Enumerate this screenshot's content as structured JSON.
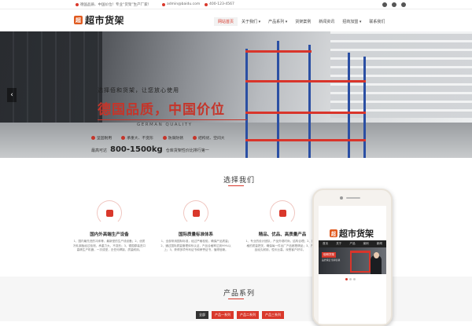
{
  "topbar": {
    "slogan": "德国品质、中国价位！专业“货架”生产厂家！",
    "email": "admin@baidu.com",
    "phone": "400-123-4567",
    "social": [
      "weibo-icon",
      "wechat-icon",
      "qq-icon"
    ]
  },
  "brand": {
    "badge": "超",
    "name": "超市货架"
  },
  "nav": {
    "items": [
      {
        "label": "网站首页",
        "active": true
      },
      {
        "label": "关于我们 ▾"
      },
      {
        "label": "产品系列 ▾"
      },
      {
        "label": "货架案例"
      },
      {
        "label": "新闻资讯"
      },
      {
        "label": "招商加盟 ▾"
      },
      {
        "label": "联系我们"
      }
    ]
  },
  "hero": {
    "kicker": "选择佰和货架，让您放心使用",
    "headline": "德国品质，中国价位",
    "subline": "GERMAN QUALITY",
    "features": [
      "坚固耐用",
      "承重大、不变形",
      "防腐防锈",
      "结构优、空间大"
    ],
    "load_label": "最高可达",
    "load_value": "800-1500kg",
    "load_tail": "仓库货架性价比排行第一",
    "prev": "‹"
  },
  "choose": {
    "title": "选择我们",
    "items": [
      {
        "icon": "gear-icon",
        "title": "国内外高端生产设备",
        "desc": "1、国内最先进的冲床等，最新型的生产线设备；2、优质冷轧钢板经过检测，承重力大，不变形；3、德国原装进口高精生产机器，一次成型，无任何焊接，质量耐用。"
      },
      {
        "icon": "check-icon",
        "title": "国际质量标准体系",
        "desc": "1、全部采用国际标准，经过严格检验，确保产品质量；2、通过国际质量管理体系认证，产品合格率达到99%以上；3、获得多项专利证书和荣誉证书，值得信赖。"
      },
      {
        "icon": "star-icon",
        "title": "精品、优品、高质量产品",
        "desc": "1、专业的设计团队，产品外观时尚，结构合理；2、严格的质量把关，确保每一件出厂产品都是精品；3、产品经久耐用，性价比高，深受客户好评。"
      }
    ]
  },
  "phone": {
    "menu": [
      "首页",
      "关于",
      "产品",
      "案例",
      "新闻"
    ],
    "banner_title": "佰和货架",
    "banner_sub": "品质保证 值得信赖"
  },
  "products": {
    "title": "产品系列",
    "tabs": [
      "全部",
      "产品一系列",
      "产品二系列",
      "产品三系列"
    ]
  },
  "colors": {
    "accent": "#d9382b",
    "brand": "#e05a1f",
    "rack_blue": "#2b4fa3"
  }
}
